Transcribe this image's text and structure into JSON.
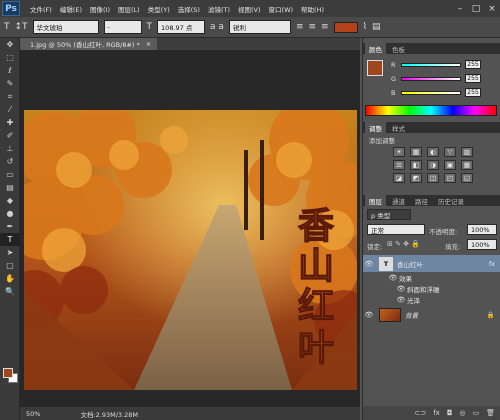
{
  "menu": {
    "logo": "Ps",
    "items": [
      "文件(F)",
      "编辑(E)",
      "图像(I)",
      "图层(L)",
      "类型(Y)",
      "选择(S)",
      "滤镜(T)",
      "视图(V)",
      "窗口(W)",
      "帮助(H)"
    ],
    "window_controls": [
      "–",
      "□",
      "×"
    ]
  },
  "options": {
    "tool_glyph": "T",
    "orient_glyph": "↕T",
    "font_family": "华文琥珀",
    "font_style": "-",
    "size_glyph": "T",
    "font_size": "108.97 点",
    "aa_glyph": "a a",
    "antialias": "锐利",
    "color": "#b3421a"
  },
  "document": {
    "tab_title": "1.jpg @ 50% (香山红叶, RGB/8#) *",
    "tab_close": "×",
    "art_text": [
      "香",
      "山",
      "红",
      "叶"
    ],
    "zoom": "50%",
    "doc_info": "文档:2.93M/3.28M"
  },
  "toolbox": {
    "tools": [
      {
        "name": "move-tool",
        "glyph": "✥"
      },
      {
        "name": "marquee-tool",
        "glyph": "⬚"
      },
      {
        "name": "lasso-tool",
        "glyph": "ℓ"
      },
      {
        "name": "quick-select-tool",
        "glyph": "✎"
      },
      {
        "name": "crop-tool",
        "glyph": "⌗"
      },
      {
        "name": "eyedropper-tool",
        "glyph": "⁄"
      },
      {
        "name": "healing-tool",
        "glyph": "✚"
      },
      {
        "name": "brush-tool",
        "glyph": "✐"
      },
      {
        "name": "stamp-tool",
        "glyph": "⊥"
      },
      {
        "name": "history-brush-tool",
        "glyph": "↺"
      },
      {
        "name": "eraser-tool",
        "glyph": "▭"
      },
      {
        "name": "gradient-tool",
        "glyph": "▤"
      },
      {
        "name": "blur-tool",
        "glyph": "◆"
      },
      {
        "name": "dodge-tool",
        "glyph": "●"
      },
      {
        "name": "pen-tool",
        "glyph": "✒"
      },
      {
        "name": "type-tool",
        "glyph": "T"
      },
      {
        "name": "path-select-tool",
        "glyph": "➤"
      },
      {
        "name": "shape-tool",
        "glyph": "▢"
      },
      {
        "name": "hand-tool",
        "glyph": "✋"
      },
      {
        "name": "zoom-tool",
        "glyph": "🔍"
      }
    ],
    "active_tool": "type-tool",
    "fg_color": "#a0461e",
    "bg_color": "#ffffff"
  },
  "color_panel": {
    "tabs": [
      "颜色",
      "色板"
    ],
    "channels": [
      {
        "label": "R",
        "value": "255"
      },
      {
        "label": "G",
        "value": "255"
      },
      {
        "label": "B",
        "value": "255"
      }
    ],
    "swatch": "#a0461e"
  },
  "adjust_panel": {
    "tabs": [
      "调整",
      "样式"
    ],
    "title": "添加调整",
    "row1": [
      "☀",
      "▦",
      "◐",
      "▽",
      "▨"
    ],
    "row2": [
      "⚖",
      "◧",
      "◑",
      "▣",
      "▦"
    ],
    "row3": [
      "◪",
      "◩",
      "◫",
      "◰",
      "◱"
    ]
  },
  "layers_panel": {
    "tabs": [
      "图层",
      "通道",
      "路径",
      "历史记录"
    ],
    "kind": "p 类型",
    "blend_mode": "正常",
    "opacity_label": "不透明度:",
    "opacity": "100%",
    "lock_label": "锁定:",
    "fill_label": "填充:",
    "fill": "100%",
    "layers": [
      {
        "name": "香山红叶",
        "type": "T",
        "fx": "fx"
      },
      {
        "name": "效果"
      },
      {
        "name": "斜面和浮雕"
      },
      {
        "name": "光泽"
      },
      {
        "name": "背景",
        "lock": "🔒"
      }
    ],
    "bottom_icons": [
      "⊂⊃",
      "fx",
      "◘",
      "◎",
      "▭",
      "🗑"
    ]
  }
}
